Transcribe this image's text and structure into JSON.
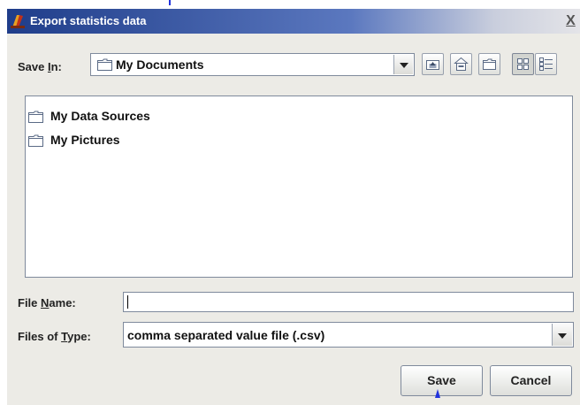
{
  "window": {
    "title": "Export statistics data",
    "close_glyph": "X"
  },
  "save_in": {
    "label_pre": "Save ",
    "label_mnemonic": "I",
    "label_post": "n:",
    "value": "My Documents"
  },
  "toolbar": {
    "buttons": [
      "up-one-level",
      "home",
      "create-new-folder",
      "list-view",
      "details-view"
    ]
  },
  "files": [
    {
      "name": "My Data Sources",
      "icon": "folder-icon"
    },
    {
      "name": "My Pictures",
      "icon": "folder-icon"
    }
  ],
  "file_name": {
    "label_pre": "File ",
    "label_mnemonic": "N",
    "label_post": "ame:",
    "value": ""
  },
  "file_type": {
    "label_pre": "Files of ",
    "label_mnemonic": "T",
    "label_post": "ype:",
    "value": "comma separated value file (.csv)"
  },
  "buttons": {
    "save": "Save",
    "cancel": "Cancel"
  },
  "colors": {
    "title_gradient_start": "#1f3d8a",
    "dialog_background": "#ecebe6",
    "pointer": "#2233dd"
  }
}
